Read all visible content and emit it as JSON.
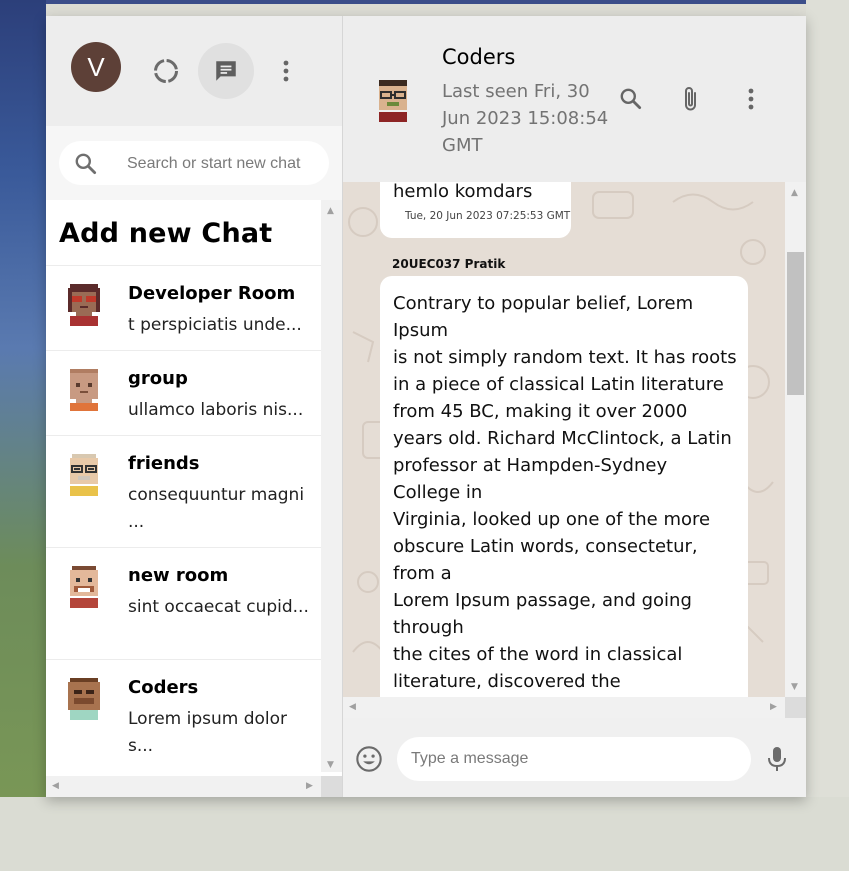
{
  "sidebar": {
    "user_initial": "V",
    "search_placeholder": "Search or start new chat",
    "add_chat_label": "Add new Chat",
    "chats": [
      {
        "name": "Developer Room",
        "snippet": "t perspiciatis unde..."
      },
      {
        "name": "group",
        "snippet": "ullamco laboris nis..."
      },
      {
        "name": "friends",
        "snippet": "consequuntur magni ..."
      },
      {
        "name": "new room",
        "snippet": "sint occaecat cupid..."
      },
      {
        "name": "Coders",
        "snippet": "Lorem ipsum dolor s..."
      }
    ]
  },
  "conversation": {
    "title": "Coders",
    "last_seen": "Last seen Fri, 30 Jun 2023 15:08:54 GMT",
    "messages": [
      {
        "text": "hemlo komdars",
        "time": "Tue, 20 Jun 2023 07:25:53 GMT"
      },
      {
        "sender": "20UEC037 Pratik",
        "text": "Contrary to popular belief, Lorem Ipsum\nis not simply random text. It has roots in a piece of classical Latin literature from 45 BC, making it over 2000 years old. Richard McClintock, a Latin professor at Hampden-Sydney College in\nVirginia, looked up one of the more obscure Latin words, consectetur, from a\nLorem Ipsum passage, and going through\nthe cites of the word in classical literature, discovered the undoubtable"
      }
    ],
    "composer_placeholder": "Type a message"
  },
  "icons": {
    "status": "status-ring-icon",
    "chat": "message-icon",
    "menu": "vertical-dots-icon",
    "search": "search-icon",
    "attach": "paperclip-icon",
    "emoji": "emoji-icon",
    "mic": "microphone-icon"
  },
  "colors": {
    "header_bg": "#ededed",
    "chat_bg": "#e5ddd5",
    "avatar_bg": "#5d4037"
  }
}
